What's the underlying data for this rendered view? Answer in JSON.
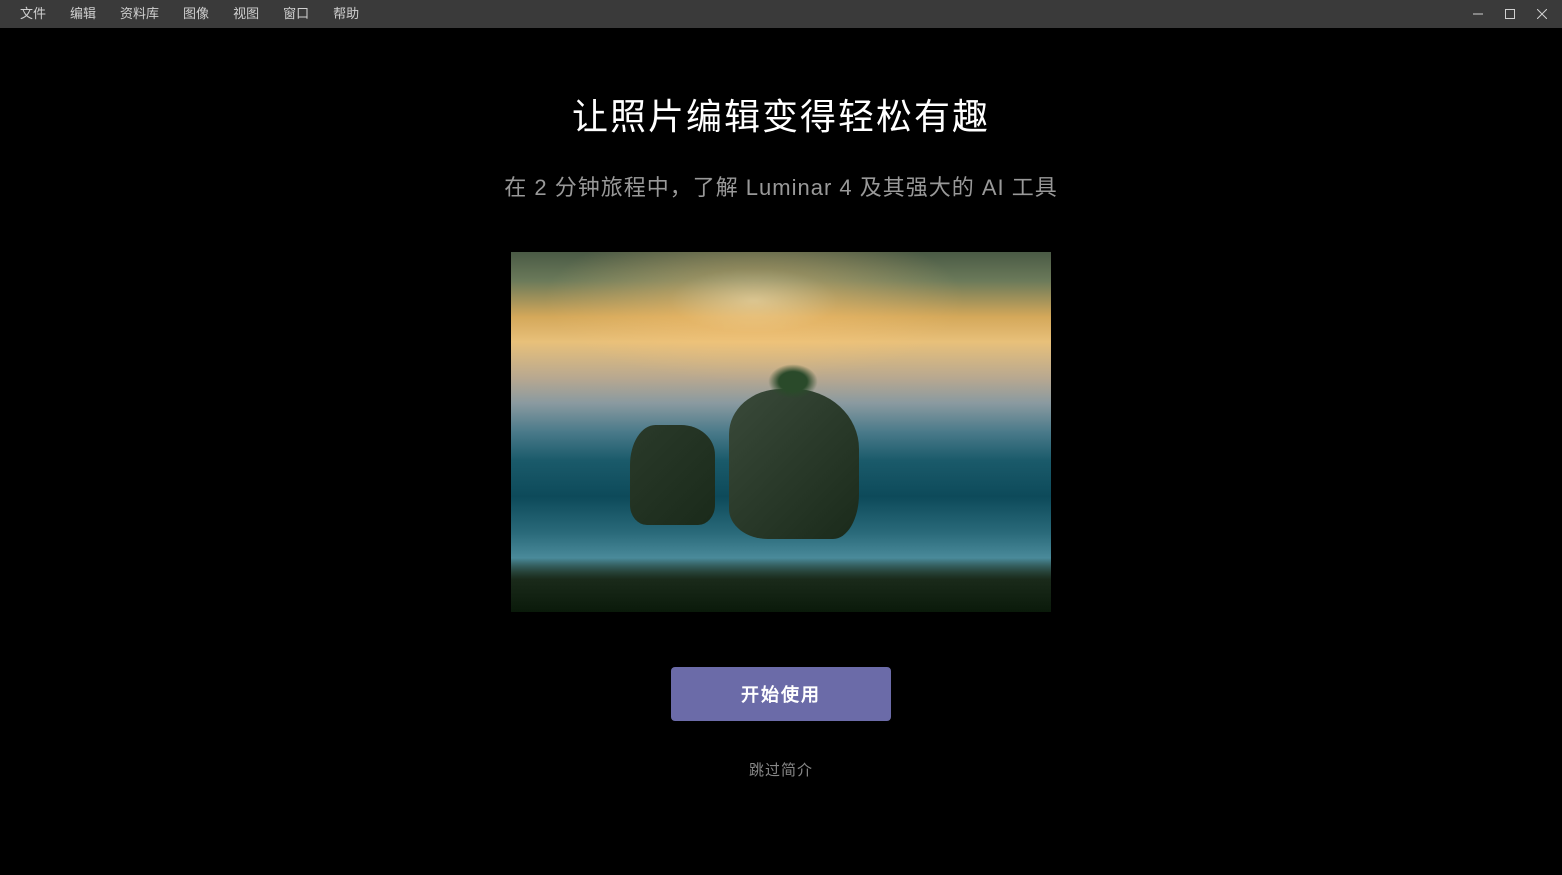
{
  "menubar": {
    "items": [
      "文件",
      "编辑",
      "资料库",
      "图像",
      "视图",
      "窗口",
      "帮助"
    ]
  },
  "content": {
    "title": "让照片编辑变得轻松有趣",
    "subtitle": "在 2 分钟旅程中，了解 Luminar 4 及其强大的 AI 工具",
    "primary_button": "开始使用",
    "skip_link": "跳过简介"
  }
}
